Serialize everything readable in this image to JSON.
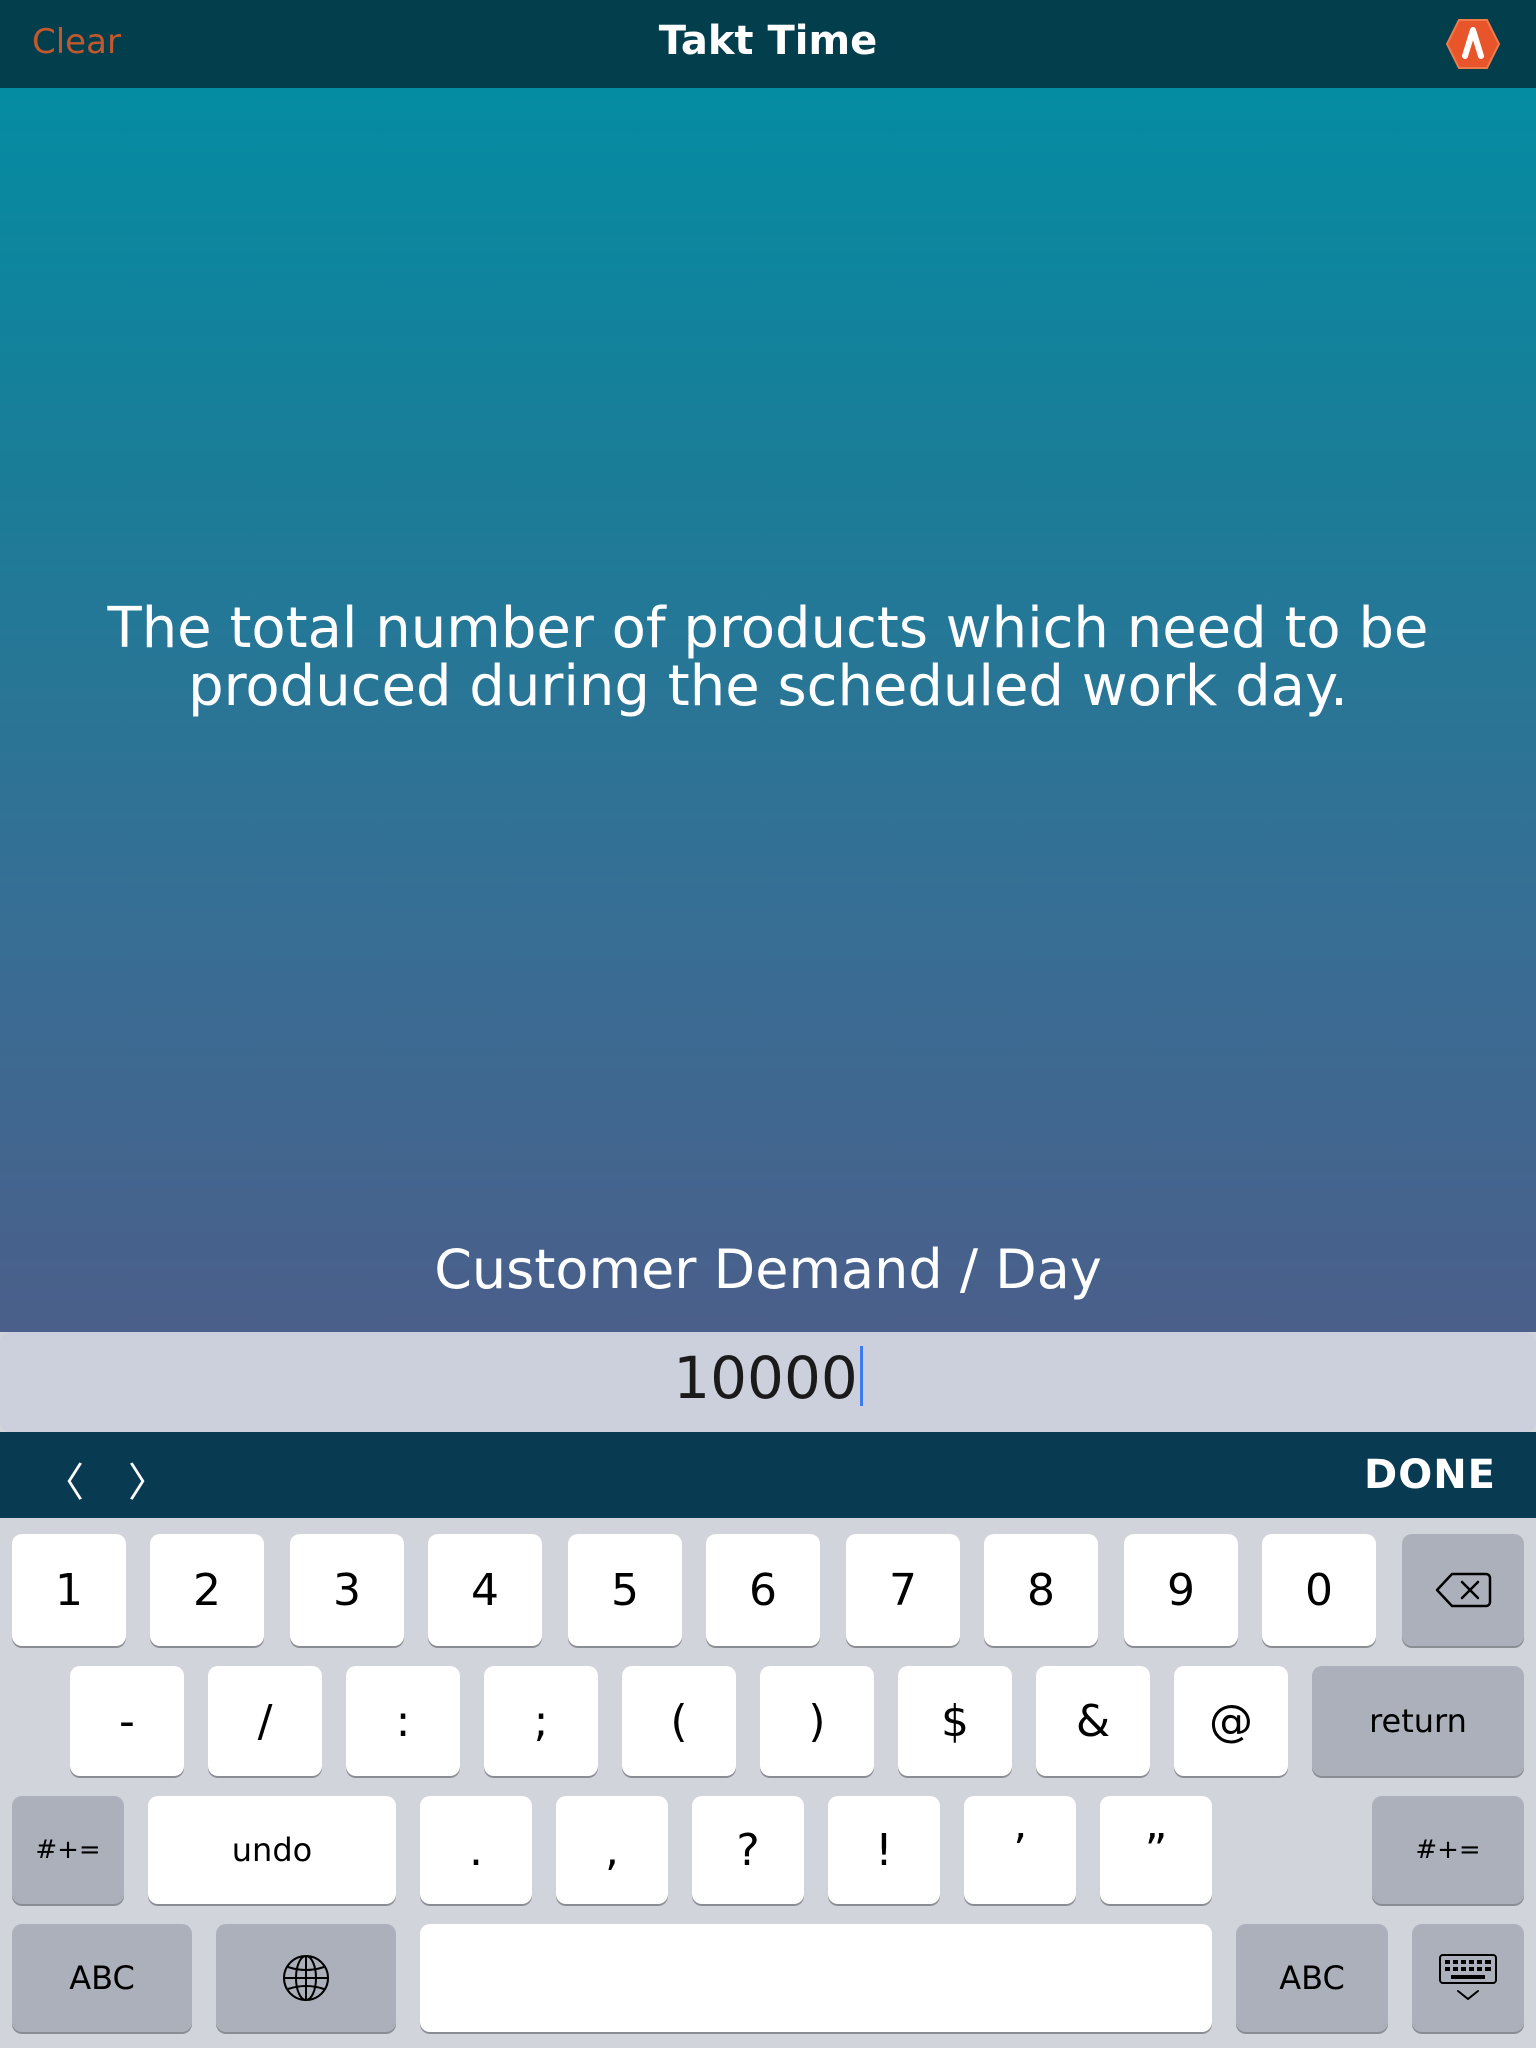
{
  "navbar": {
    "clear_label": "Clear",
    "title": "Takt Time",
    "logo_icon": "app-logo-icon",
    "logo_color": "#e8552a"
  },
  "content": {
    "description_line1": "The total number of products which need to be",
    "description_line2": "produced during the scheduled work day.",
    "field_label": "Customer Demand / Day"
  },
  "input": {
    "value": "10000"
  },
  "accessory": {
    "prev_label": "〈",
    "next_label": "〉",
    "done_label": "DONE"
  },
  "keyboard": {
    "row1": [
      "1",
      "2",
      "3",
      "4",
      "5",
      "6",
      "7",
      "8",
      "9",
      "0"
    ],
    "delete_icon": "backspace-icon",
    "row2": [
      "-",
      "/",
      ":",
      ";",
      "(",
      ")",
      "$",
      "&",
      "@"
    ],
    "return_label": "return",
    "symbols_label": "#+=",
    "undo_label": "undo",
    "row3": [
      ".",
      ",",
      "?",
      "!",
      "’",
      "”"
    ],
    "abc_label": "ABC",
    "globe_icon": "globe-icon",
    "hide_keyboard_icon": "keyboard-dismiss-icon"
  }
}
